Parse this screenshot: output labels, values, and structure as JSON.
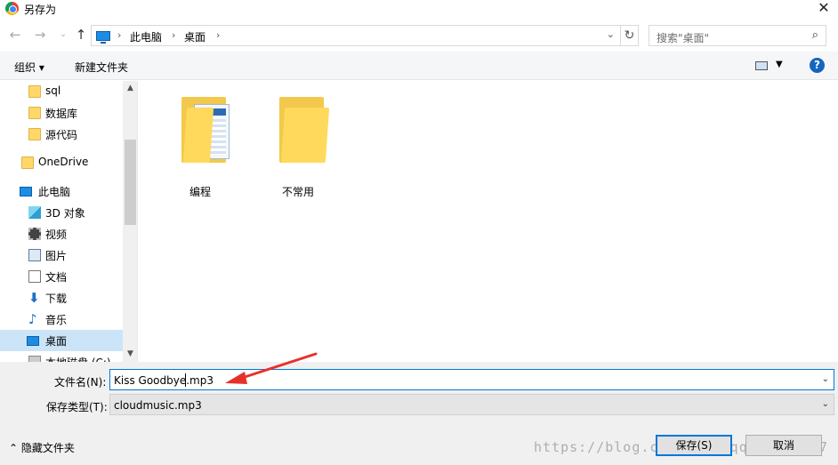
{
  "window": {
    "title": "另存为"
  },
  "breadcrumb": [
    "此电脑",
    "桌面"
  ],
  "search": {
    "placeholder": "搜索\"桌面\""
  },
  "toolbar": {
    "organize": "组织 ▾",
    "new_folder": "新建文件夹"
  },
  "sidebar": {
    "items": [
      {
        "label": "sql",
        "icon": "folder"
      },
      {
        "label": "数据库",
        "icon": "folder"
      },
      {
        "label": "源代码",
        "icon": "folder"
      },
      {
        "label": "OneDrive",
        "icon": "folder"
      },
      {
        "label": "此电脑",
        "icon": "pc"
      },
      {
        "label": "3D 对象",
        "icon": "cube"
      },
      {
        "label": "视频",
        "icon": "video"
      },
      {
        "label": "图片",
        "icon": "picture"
      },
      {
        "label": "文档",
        "icon": "doc"
      },
      {
        "label": "下载",
        "icon": "download"
      },
      {
        "label": "音乐",
        "icon": "music"
      },
      {
        "label": "桌面",
        "icon": "pc",
        "selected": true
      },
      {
        "label": "本地磁盘 (C:)",
        "icon": "disk"
      }
    ]
  },
  "files": [
    {
      "name": "编程",
      "icon": "folder-with-documents"
    },
    {
      "name": "不常用",
      "icon": "folder"
    }
  ],
  "form": {
    "filename_label": "文件名(N):",
    "filename_value": "Kiss Goodbye.mp3",
    "filetype_label": "保存类型(T):",
    "filetype_value": "cloudmusic.mp3"
  },
  "footer": {
    "hide_folders": "隐藏文件夹",
    "save": "保存(S)",
    "cancel": "取消",
    "watermark": "https://blog.csdn.net/qq_37553797"
  },
  "colors": {
    "accent": "#0078d7",
    "selected": "#cce4f7",
    "annotation_arrow": "#e8302a"
  }
}
